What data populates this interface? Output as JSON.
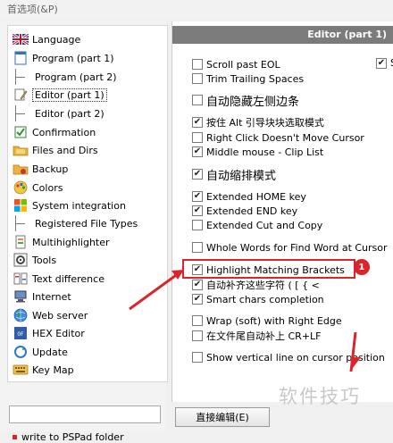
{
  "window": {
    "title": "首选项(&P)"
  },
  "sidebar": {
    "items": [
      {
        "label": "Language",
        "icon": "uk-flag-icon"
      },
      {
        "label": "Program  (part 1)",
        "icon": "document-icon"
      },
      {
        "label": "Program  (part 2)",
        "icon": ""
      },
      {
        "label": "Editor  (part 1)",
        "icon": "pencil-document-icon"
      },
      {
        "label": "Editor  (part 2)",
        "icon": ""
      },
      {
        "label": "Confirmation",
        "icon": "checklist-icon"
      },
      {
        "label": "Files and Dirs",
        "icon": "folders-icon"
      },
      {
        "label": "Backup",
        "icon": "backup-folder-icon"
      },
      {
        "label": "Colors",
        "icon": "palette-icon"
      },
      {
        "label": "System integration",
        "icon": "windows-logo-icon"
      },
      {
        "label": "Registered File Types",
        "icon": ""
      },
      {
        "label": "Multihighlighter",
        "icon": "highlighter-document-icon"
      },
      {
        "label": "Tools",
        "icon": "gear-icon"
      },
      {
        "label": "Text difference",
        "icon": "compare-icon"
      },
      {
        "label": "Internet",
        "icon": "network-icon"
      },
      {
        "label": "Web server",
        "icon": "globe-icon"
      },
      {
        "label": "HEX Editor",
        "icon": "hex-icon"
      },
      {
        "label": "Update",
        "icon": "update-icon"
      },
      {
        "label": "Key Map",
        "icon": "keyboard-icon"
      }
    ],
    "filter_value": "",
    "write_to_folder": "write to PSPad folder"
  },
  "panel": {
    "header": "Editor  (part 1)",
    "right_column_label": "S",
    "options": [
      {
        "label": "Scroll past EOL",
        "checked": false
      },
      {
        "label": "Trim Trailing Spaces",
        "checked": false
      },
      {
        "label": "自动隐藏左侧边条",
        "checked": false
      },
      {
        "label": "按住 Alt 引导块块选取模式",
        "checked": true
      },
      {
        "label": "Right Click Doesn't Move Cursor",
        "checked": false
      },
      {
        "label": "Middle mouse - Clip List",
        "checked": true
      },
      {
        "label": "自动缩排模式",
        "checked": true
      },
      {
        "label": "Extended HOME key",
        "checked": true
      },
      {
        "label": "Extended END key",
        "checked": true
      },
      {
        "label": "Extended Cut and Copy",
        "checked": false
      },
      {
        "label": "Whole Words for Find Word at Cursor",
        "checked": false
      },
      {
        "label": "Highlight Matching Brackets",
        "checked": true
      },
      {
        "label": "自动补齐这些字符 ( [ { <",
        "checked": true
      },
      {
        "label": "Smart chars completion",
        "checked": true
      },
      {
        "label": "Wrap (soft) with Right Edge",
        "checked": false
      },
      {
        "label": "在文件尾自动补上 CR+LF",
        "checked": false
      },
      {
        "label": "Show vertical line on cursor position",
        "checked": false
      }
    ],
    "right_column_checked": true
  },
  "annotation": {
    "badge": "1"
  },
  "bottom": {
    "edit_button": "直接编辑(E)"
  },
  "watermark": "软件技巧",
  "colors": {
    "accent_red": "#d9262c",
    "header_gray": "#7b7b7b"
  }
}
